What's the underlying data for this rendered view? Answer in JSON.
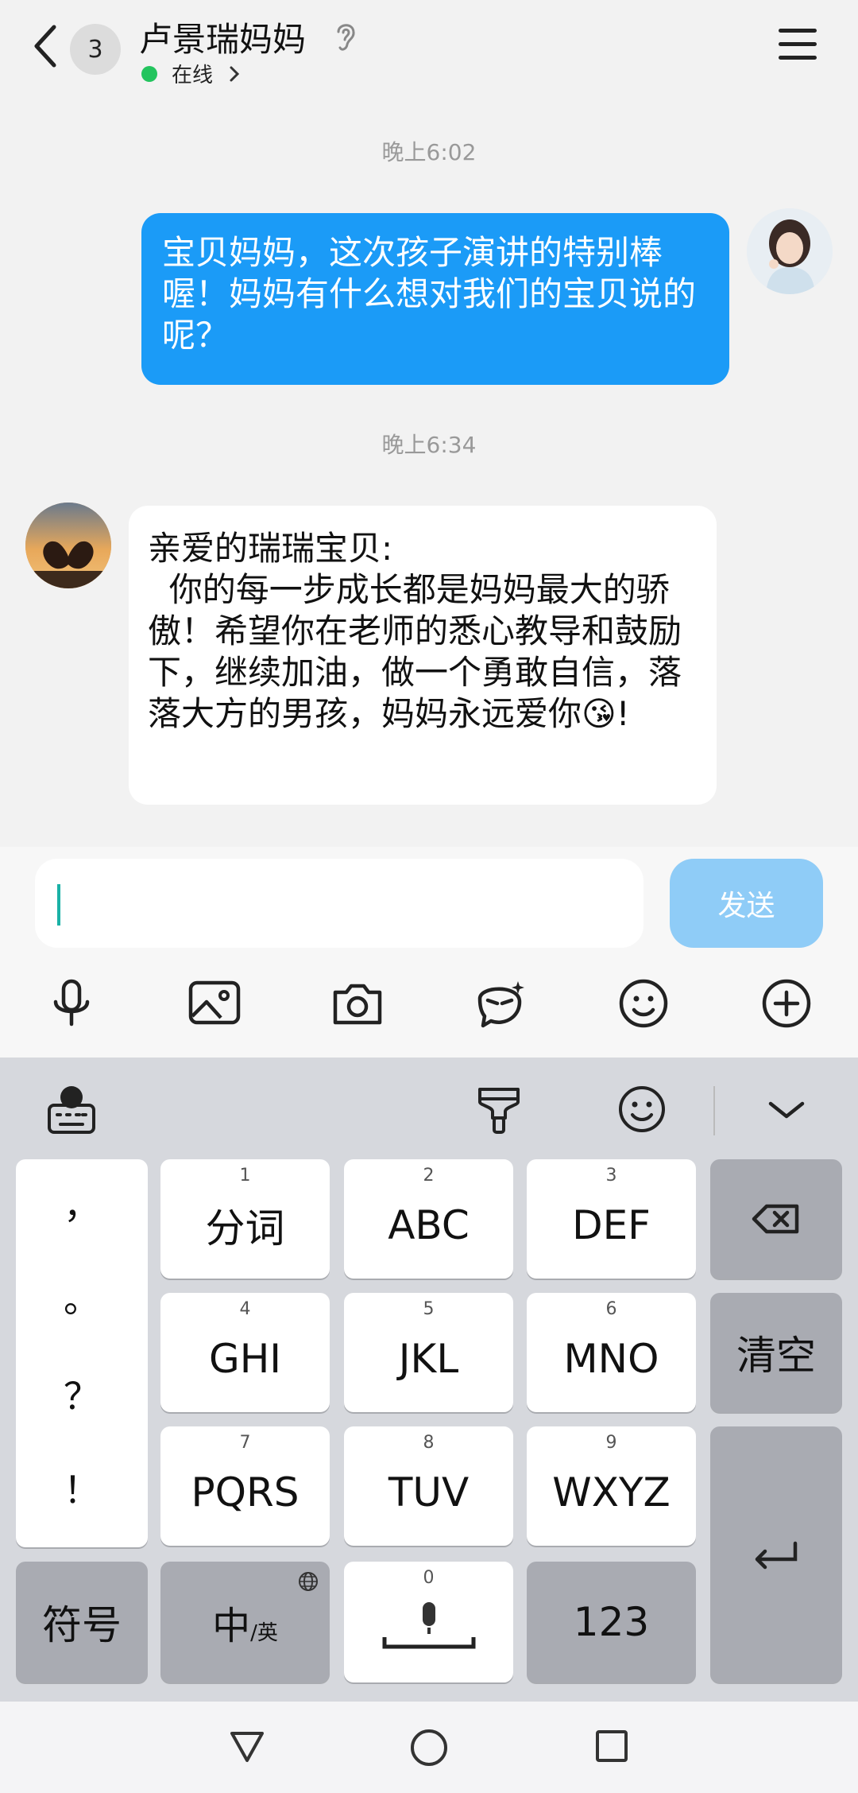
{
  "header": {
    "unread_count": "3",
    "contact_name": "卢景瑞妈妈",
    "status": "在线"
  },
  "messages": [
    {
      "time": "晚上6:02",
      "direction": "outgoing",
      "text": "宝贝妈妈，这次孩子演讲的特别棒喔！妈妈有什么想对我们的宝贝说的呢？"
    },
    {
      "time": "晚上6:34",
      "direction": "incoming",
      "text": "亲爱的瑞瑞宝贝:\n  你的每一步成长都是妈妈最大的骄傲！希望你在老师的悉心教导和鼓励下，继续加油，做一个勇敢自信，落落大方的男孩，妈妈永远爱你😘!"
    }
  ],
  "composer": {
    "value": "",
    "send_label": "发送"
  },
  "toolbar": {
    "icons": [
      "microphone-icon",
      "image-icon",
      "camera-icon",
      "sticker-icon",
      "emoji-icon",
      "plus-icon"
    ]
  },
  "keyboard": {
    "punctuation": [
      "，",
      "。",
      "？",
      "！"
    ],
    "keys": [
      {
        "num": "1",
        "label": "分词"
      },
      {
        "num": "2",
        "label": "ABC"
      },
      {
        "num": "3",
        "label": "DEF"
      },
      {
        "num": "4",
        "label": "GHI"
      },
      {
        "num": "5",
        "label": "JKL"
      },
      {
        "num": "6",
        "label": "MNO"
      },
      {
        "num": "7",
        "label": "PQRS"
      },
      {
        "num": "8",
        "label": "TUV"
      },
      {
        "num": "9",
        "label": "WXYZ"
      }
    ],
    "clear": "清空",
    "symbols": "符号",
    "lang_main": "中",
    "lang_alt": "/英",
    "space_num": "0",
    "numeric": "123"
  },
  "colors": {
    "outgoing_bubble": "#1b9bf7",
    "send_button": "#8fccf7",
    "online_dot": "#23c45e"
  }
}
